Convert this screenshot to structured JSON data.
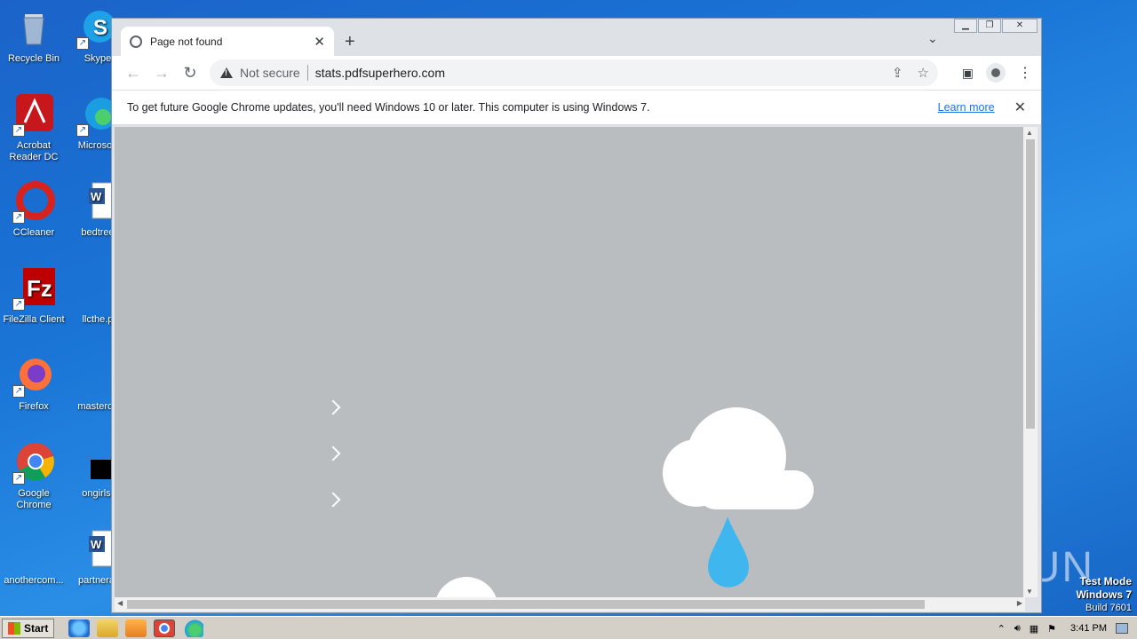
{
  "desktop": {
    "icons": [
      {
        "label": "Recycle Bin"
      },
      {
        "label": "Skype"
      },
      {
        "label": "Acrobat Reader DC"
      },
      {
        "label": "Microsoft"
      },
      {
        "label": "CCleaner"
      },
      {
        "label": "bedtree"
      },
      {
        "label": "FileZilla Client"
      },
      {
        "label": "llcthe.p"
      },
      {
        "label": "Firefox"
      },
      {
        "label": "masterco"
      },
      {
        "label": "Google Chrome"
      },
      {
        "label": "ongirls."
      },
      {
        "label": "anothercom..."
      },
      {
        "label": "partnerat"
      }
    ]
  },
  "browser": {
    "tab_title": "Page not found",
    "security_label": "Not secure",
    "url": "stats.pdfsuperhero.com",
    "infobar_text": "To get future Google Chrome updates, you'll need Windows 10 or later. This computer is using Windows 7.",
    "infobar_link": "Learn more",
    "window_controls": [
      "minimize",
      "restore",
      "close"
    ]
  },
  "taskbar": {
    "start_label": "Start",
    "clock": "3:41 PM"
  },
  "overlay": {
    "watermark": "ANY RUN",
    "testmode_line1": "Test Mode",
    "testmode_line2": "Windows 7",
    "testmode_line3": "Build 7601"
  }
}
